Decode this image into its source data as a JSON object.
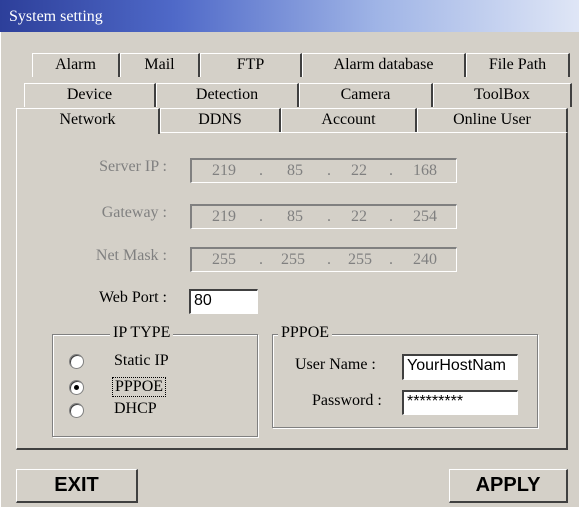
{
  "window": {
    "title": "System setting"
  },
  "tabs": {
    "row1": [
      "Alarm",
      "Mail",
      "FTP",
      "Alarm database",
      "File Path"
    ],
    "row2": [
      "Device",
      "Detection",
      "Camera",
      "ToolBox"
    ],
    "row3": [
      "Network",
      "DDNS",
      "Account",
      "Online User"
    ],
    "active": "Network"
  },
  "network": {
    "server_ip": {
      "label": "Server IP :",
      "octets": [
        "219",
        "85",
        "22",
        "168"
      ]
    },
    "gateway": {
      "label": "Gateway :",
      "octets": [
        "219",
        "85",
        "22",
        "254"
      ]
    },
    "net_mask": {
      "label": "Net Mask :",
      "octets": [
        "255",
        "255",
        "255",
        "240"
      ]
    },
    "web_port": {
      "label": "Web Port :",
      "value": "80"
    },
    "dot": "."
  },
  "ip_type": {
    "title": "IP TYPE",
    "options": [
      "Static IP",
      "PPPOE",
      "DHCP"
    ],
    "selected": "PPPOE"
  },
  "pppoe": {
    "title": "PPPOE",
    "user_label": "User Name :",
    "user_value": "YourHostNam",
    "password_label": "Password :",
    "password_value": "*********"
  },
  "buttons": {
    "exit": "EXIT",
    "apply": "APPLY"
  }
}
